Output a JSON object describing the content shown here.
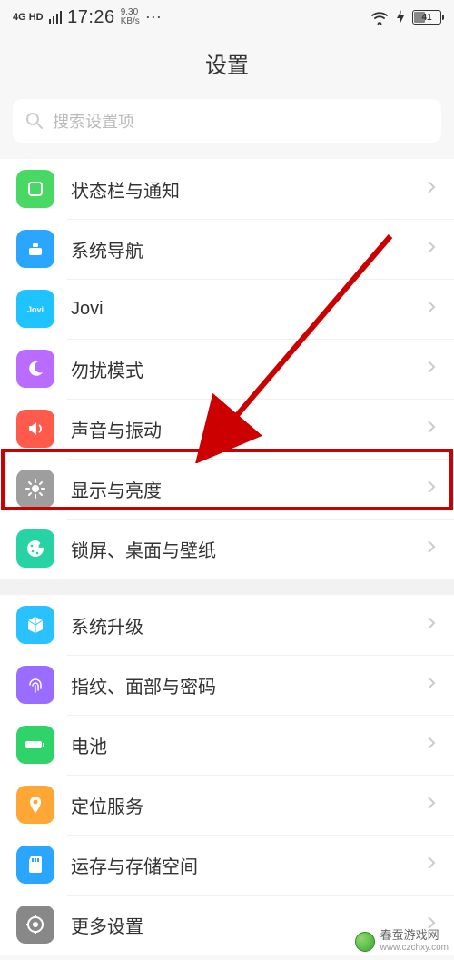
{
  "status": {
    "net_type": "4G HD",
    "time": "17:26",
    "speed_value": "9.30",
    "speed_unit": "KB/s",
    "battery": "41"
  },
  "header": {
    "title": "设置"
  },
  "search": {
    "placeholder": "搜索设置项"
  },
  "group1": [
    {
      "id": "status-notif",
      "label": "状态栏与通知",
      "color": "#4ad864",
      "icon": "square"
    },
    {
      "id": "nav",
      "label": "系统导航",
      "color": "#2aa6ff",
      "icon": "nav"
    },
    {
      "id": "jovi",
      "label": "Jovi",
      "color": "#1fc3ff",
      "icon": "jovi"
    },
    {
      "id": "dnd",
      "label": "勿扰模式",
      "color": "#b96cff",
      "icon": "moon"
    },
    {
      "id": "sound",
      "label": "声音与振动",
      "color": "#ff5a4c",
      "icon": "speaker"
    },
    {
      "id": "display",
      "label": "显示与亮度",
      "color": "#9e9e9e",
      "icon": "brightness"
    },
    {
      "id": "lock",
      "label": "锁屏、桌面与壁纸",
      "color": "#27d2a3",
      "icon": "palette"
    }
  ],
  "group2": [
    {
      "id": "update",
      "label": "系统升级",
      "color": "#29c2ff",
      "icon": "cube"
    },
    {
      "id": "biometric",
      "label": "指纹、面部与密码",
      "color": "#9a6cff",
      "icon": "fingerprint"
    },
    {
      "id": "battery",
      "label": "电池",
      "color": "#2fd36a",
      "icon": "battery"
    },
    {
      "id": "location",
      "label": "定位服务",
      "color": "#ffa734",
      "icon": "pin"
    },
    {
      "id": "storage",
      "label": "运存与存储空间",
      "color": "#2aa6ff",
      "icon": "sd"
    },
    {
      "id": "more",
      "label": "更多设置",
      "color": "#888",
      "icon": "gear"
    }
  ],
  "watermark": {
    "name": "春蚕游戏网",
    "url": "www.czchxy.com"
  }
}
